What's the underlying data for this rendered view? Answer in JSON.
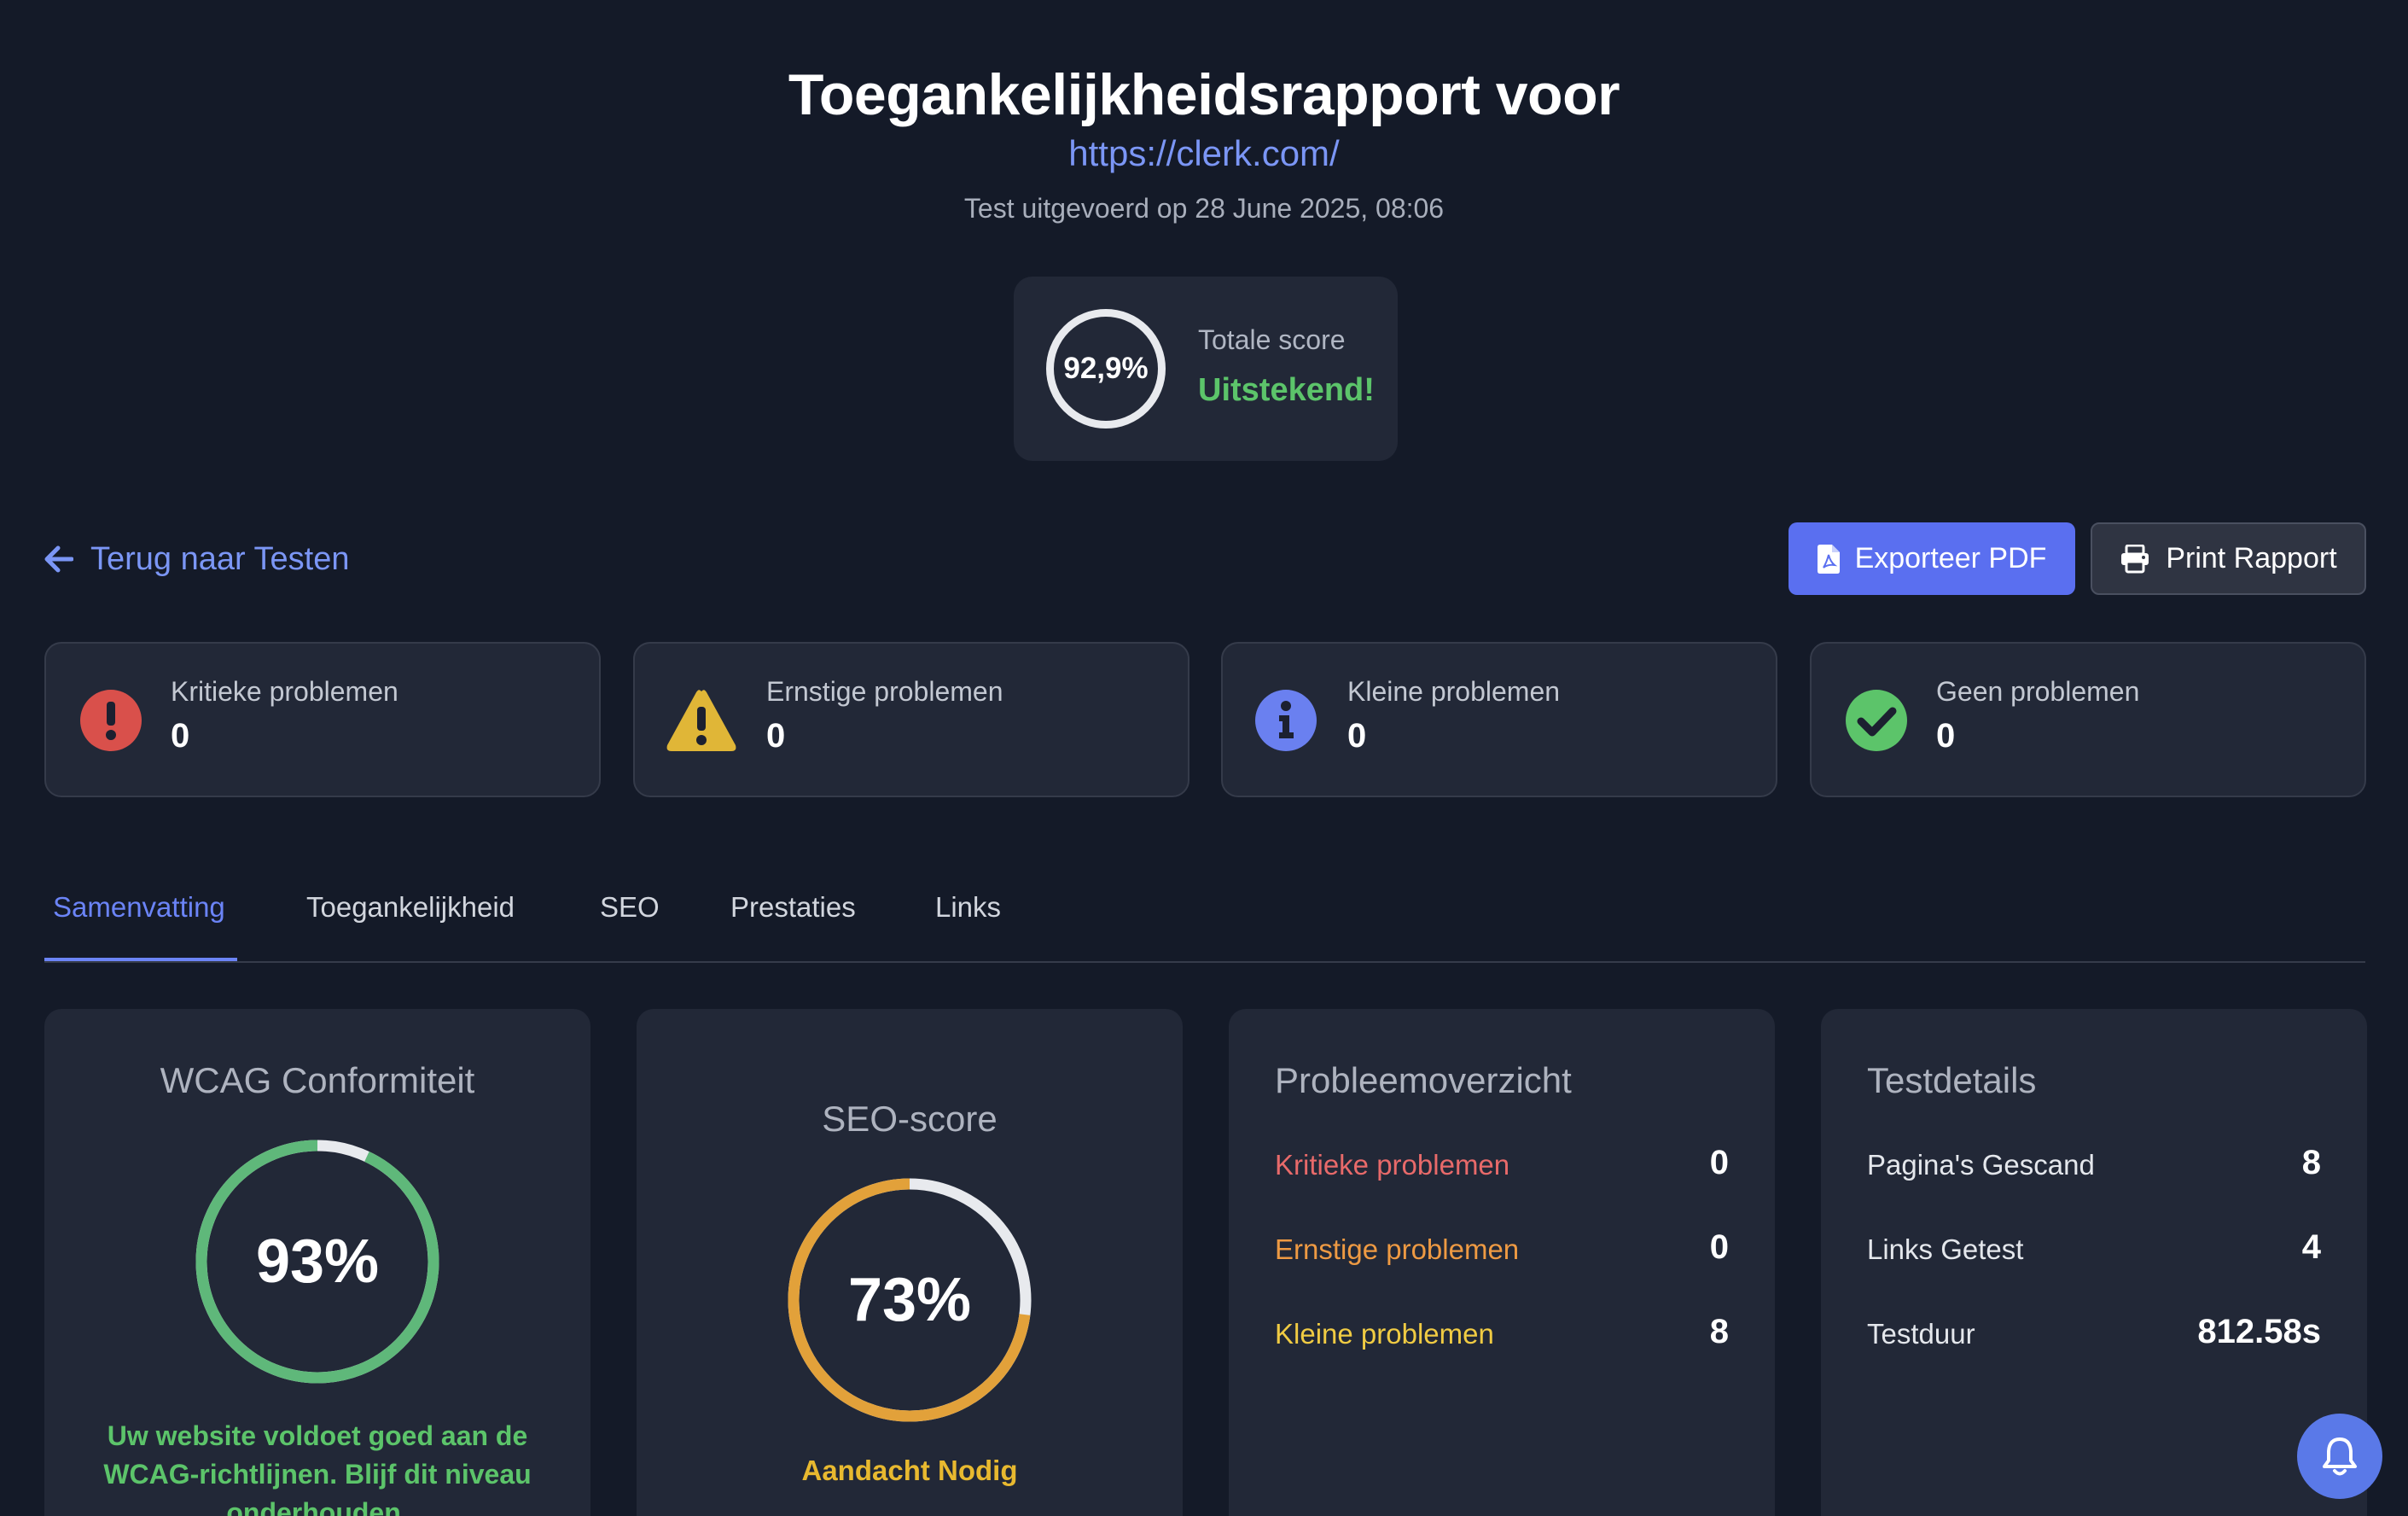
{
  "header": {
    "title": "Toegankelijkheidsrapport voor",
    "url": "https://clerk.com/",
    "date": "Test uitgevoerd op 28 June 2025, 08:06"
  },
  "total_score": {
    "value": "92,9%",
    "label": "Totale score",
    "verdict": "Uitstekend!"
  },
  "nav": {
    "back_label": "Terug naar Testen",
    "export_label": "Exporteer PDF",
    "print_label": "Print Rapport"
  },
  "issues": [
    {
      "label": "Kritieke problemen",
      "count": "0",
      "icon": "exclamation-circle-icon",
      "color": "#d9504b"
    },
    {
      "label": "Ernstige problemen",
      "count": "0",
      "icon": "warning-triangle-icon",
      "color": "#e0b637"
    },
    {
      "label": "Kleine problemen",
      "count": "0",
      "icon": "info-circle-icon",
      "color": "#6a80f0"
    },
    {
      "label": "Geen problemen",
      "count": "0",
      "icon": "check-circle-icon",
      "color": "#5cc46a"
    }
  ],
  "tabs": [
    "Samenvatting",
    "Toegankelijkheid",
    "SEO",
    "Prestaties",
    "Links"
  ],
  "active_tab": "Samenvatting",
  "wcag": {
    "title": "WCAG Conformiteit",
    "score_text": "93%",
    "score_fraction": 0.93,
    "message": "Uw website voldoet goed aan de WCAG-richtlijnen. Blijf dit niveau onderhouden.",
    "color": "#5fb87a"
  },
  "seo": {
    "title": "SEO-score",
    "score_text": "73%",
    "score_fraction": 0.73,
    "status": "Aandacht Nodig",
    "color": "#e2a13a"
  },
  "overview": {
    "title": "Probleemoverzicht",
    "rows": [
      {
        "label": "Kritieke problemen",
        "value": "0",
        "color": "#e86a6a"
      },
      {
        "label": "Ernstige problemen",
        "value": "0",
        "color": "#ee9a43"
      },
      {
        "label": "Kleine problemen",
        "value": "8",
        "color": "#f0cb43"
      }
    ]
  },
  "details": {
    "title": "Testdetails",
    "rows": [
      {
        "label": "Pagina's Gescand",
        "value": "8"
      },
      {
        "label": "Links Getest",
        "value": "4"
      },
      {
        "label": "Testduur",
        "value": "812.58s"
      }
    ]
  }
}
